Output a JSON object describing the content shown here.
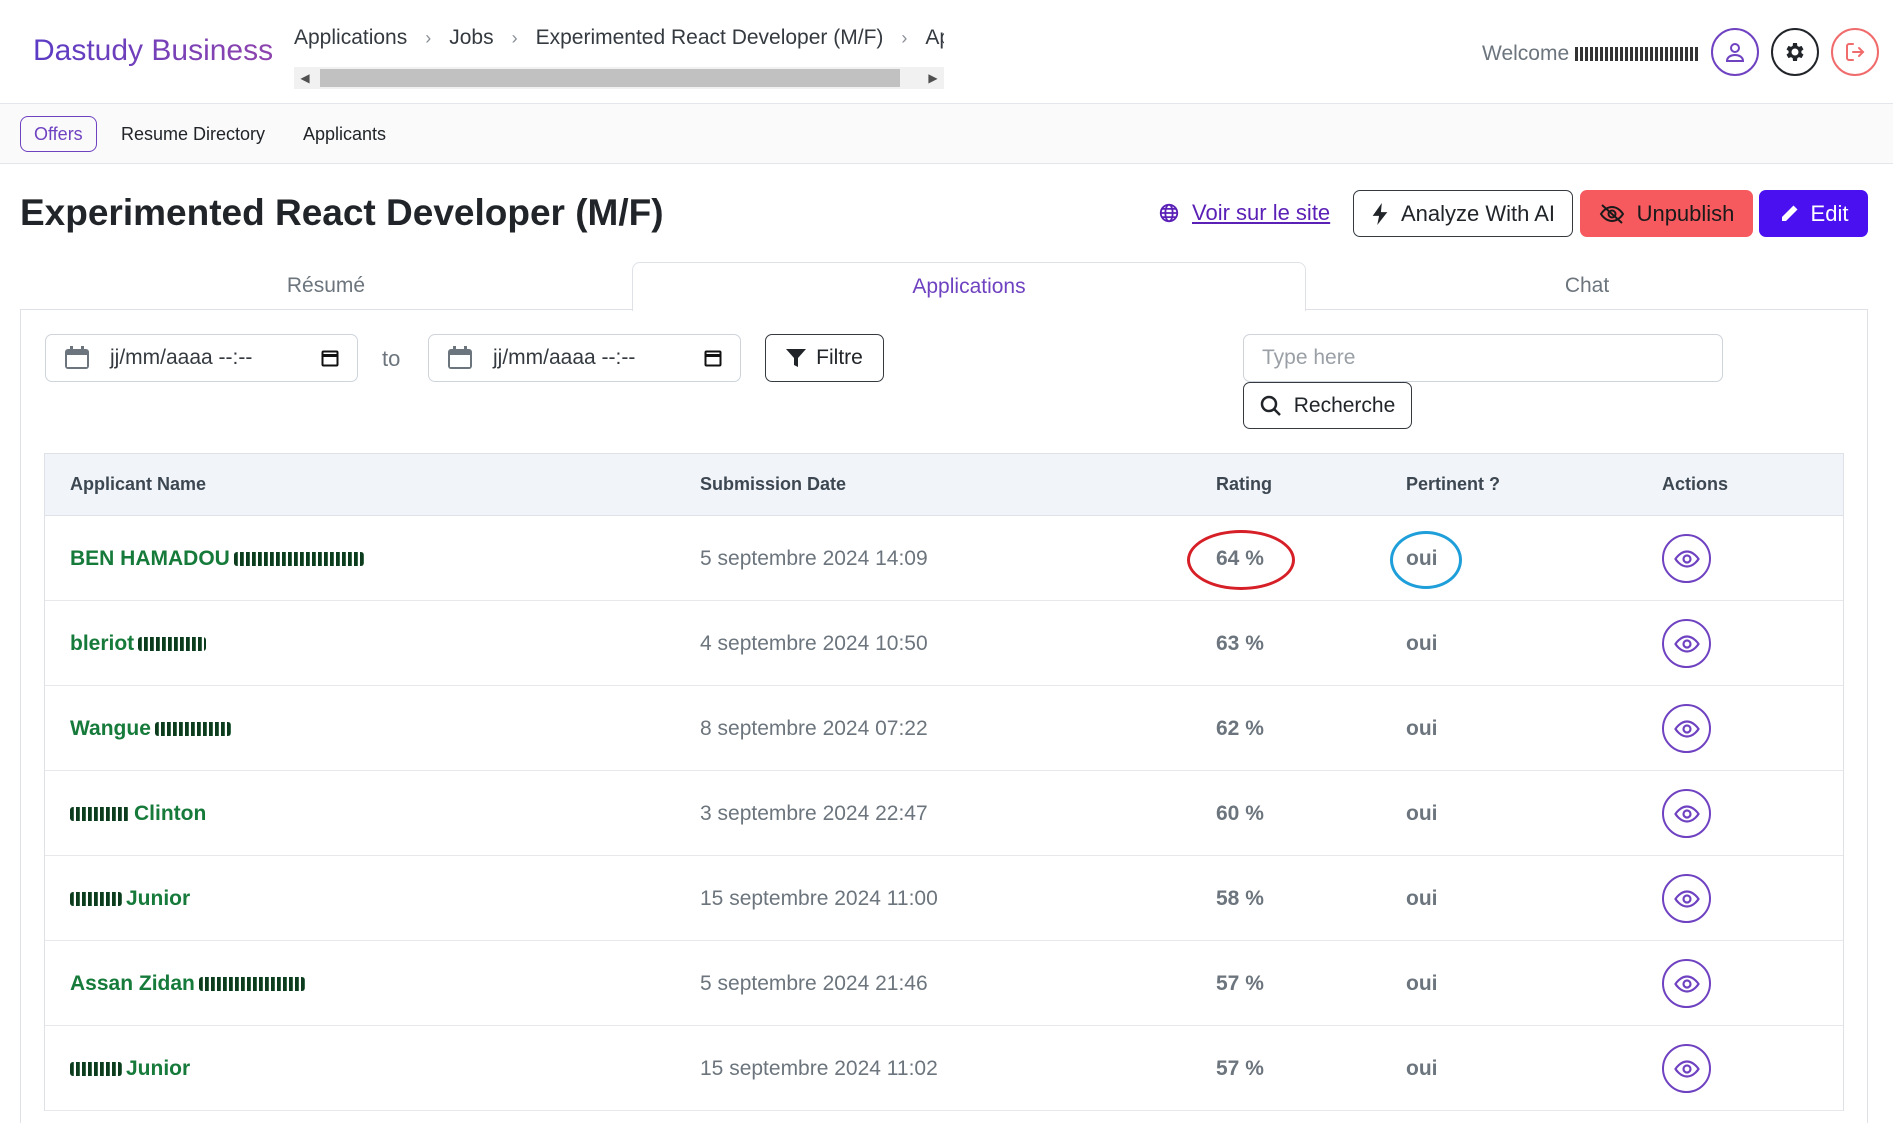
{
  "brand": "Dastudy Business",
  "breadcrumb": [
    "Applications",
    "Jobs",
    "Experimented React Developer (M/F)",
    "App"
  ],
  "header": {
    "welcome": "Welcome"
  },
  "subnav": {
    "offers": "Offers",
    "resume_directory": "Resume Directory",
    "applicants": "Applicants"
  },
  "page": {
    "title": "Experimented React Developer (M/F)",
    "site_link": "Voir sur le site",
    "analyze": "Analyze With AI",
    "unpublish": "Unpublish",
    "edit": "Edit"
  },
  "tabs": {
    "resume": "Résumé",
    "applications": "Applications",
    "chat": "Chat"
  },
  "filters": {
    "date_placeholder": "jj/mm/aaaa --:--",
    "to": "to",
    "filter_button": "Filtre",
    "search_placeholder": "Type here",
    "search_button": "Recherche"
  },
  "table": {
    "headers": {
      "name": "Applicant Name",
      "date": "Submission Date",
      "rating": "Rating",
      "pertinent": "Pertinent ?",
      "actions": "Actions"
    },
    "rows": [
      {
        "first": "BEN HAMADOU",
        "last": "",
        "date": "5 septembre 2024 14:09",
        "rating": "64 %",
        "pertinent": "oui"
      },
      {
        "first": "bleriot",
        "last": "",
        "date": "4 septembre 2024 10:50",
        "rating": "63 %",
        "pertinent": "oui"
      },
      {
        "first": "Wangue",
        "last": "",
        "date": "8 septembre 2024 07:22",
        "rating": "62 %",
        "pertinent": "oui"
      },
      {
        "first": "",
        "last": "Clinton",
        "date": "3 septembre 2024 22:47",
        "rating": "60 %",
        "pertinent": "oui"
      },
      {
        "first": "",
        "last": "Junior",
        "date": "15 septembre 2024 11:00",
        "rating": "58 %",
        "pertinent": "oui"
      },
      {
        "first": "Assan Zidan",
        "last": "",
        "date": "5 septembre 2024 21:46",
        "rating": "57 %",
        "pertinent": "oui"
      },
      {
        "first": "",
        "last": "Junior",
        "date": "15 septembre 2024 11:02",
        "rating": "57 %",
        "pertinent": "oui"
      }
    ]
  },
  "colors": {
    "accent": "#6f42c1",
    "danger": "#f65a5f",
    "primary": "#4a10f0",
    "success_text": "#157a3a"
  }
}
